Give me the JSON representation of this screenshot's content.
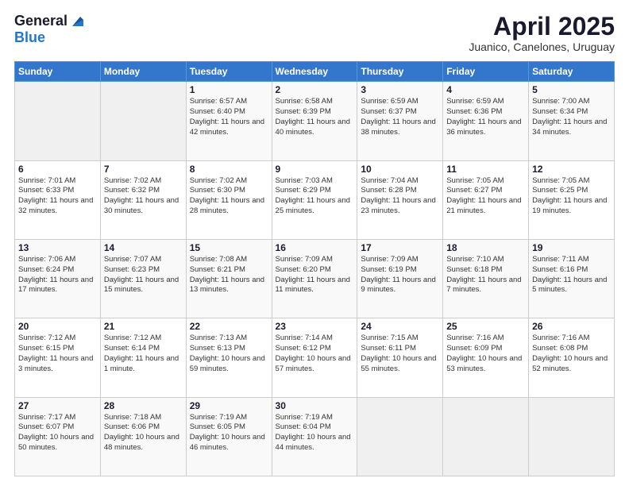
{
  "header": {
    "logo_general": "General",
    "logo_blue": "Blue",
    "month_title": "April 2025",
    "subtitle": "Juanico, Canelones, Uruguay"
  },
  "days_of_week": [
    "Sunday",
    "Monday",
    "Tuesday",
    "Wednesday",
    "Thursday",
    "Friday",
    "Saturday"
  ],
  "weeks": [
    [
      {
        "day": "",
        "info": ""
      },
      {
        "day": "",
        "info": ""
      },
      {
        "day": "1",
        "info": "Sunrise: 6:57 AM\nSunset: 6:40 PM\nDaylight: 11 hours and 42 minutes."
      },
      {
        "day": "2",
        "info": "Sunrise: 6:58 AM\nSunset: 6:39 PM\nDaylight: 11 hours and 40 minutes."
      },
      {
        "day": "3",
        "info": "Sunrise: 6:59 AM\nSunset: 6:37 PM\nDaylight: 11 hours and 38 minutes."
      },
      {
        "day": "4",
        "info": "Sunrise: 6:59 AM\nSunset: 6:36 PM\nDaylight: 11 hours and 36 minutes."
      },
      {
        "day": "5",
        "info": "Sunrise: 7:00 AM\nSunset: 6:34 PM\nDaylight: 11 hours and 34 minutes."
      }
    ],
    [
      {
        "day": "6",
        "info": "Sunrise: 7:01 AM\nSunset: 6:33 PM\nDaylight: 11 hours and 32 minutes."
      },
      {
        "day": "7",
        "info": "Sunrise: 7:02 AM\nSunset: 6:32 PM\nDaylight: 11 hours and 30 minutes."
      },
      {
        "day": "8",
        "info": "Sunrise: 7:02 AM\nSunset: 6:30 PM\nDaylight: 11 hours and 28 minutes."
      },
      {
        "day": "9",
        "info": "Sunrise: 7:03 AM\nSunset: 6:29 PM\nDaylight: 11 hours and 25 minutes."
      },
      {
        "day": "10",
        "info": "Sunrise: 7:04 AM\nSunset: 6:28 PM\nDaylight: 11 hours and 23 minutes."
      },
      {
        "day": "11",
        "info": "Sunrise: 7:05 AM\nSunset: 6:27 PM\nDaylight: 11 hours and 21 minutes."
      },
      {
        "day": "12",
        "info": "Sunrise: 7:05 AM\nSunset: 6:25 PM\nDaylight: 11 hours and 19 minutes."
      }
    ],
    [
      {
        "day": "13",
        "info": "Sunrise: 7:06 AM\nSunset: 6:24 PM\nDaylight: 11 hours and 17 minutes."
      },
      {
        "day": "14",
        "info": "Sunrise: 7:07 AM\nSunset: 6:23 PM\nDaylight: 11 hours and 15 minutes."
      },
      {
        "day": "15",
        "info": "Sunrise: 7:08 AM\nSunset: 6:21 PM\nDaylight: 11 hours and 13 minutes."
      },
      {
        "day": "16",
        "info": "Sunrise: 7:09 AM\nSunset: 6:20 PM\nDaylight: 11 hours and 11 minutes."
      },
      {
        "day": "17",
        "info": "Sunrise: 7:09 AM\nSunset: 6:19 PM\nDaylight: 11 hours and 9 minutes."
      },
      {
        "day": "18",
        "info": "Sunrise: 7:10 AM\nSunset: 6:18 PM\nDaylight: 11 hours and 7 minutes."
      },
      {
        "day": "19",
        "info": "Sunrise: 7:11 AM\nSunset: 6:16 PM\nDaylight: 11 hours and 5 minutes."
      }
    ],
    [
      {
        "day": "20",
        "info": "Sunrise: 7:12 AM\nSunset: 6:15 PM\nDaylight: 11 hours and 3 minutes."
      },
      {
        "day": "21",
        "info": "Sunrise: 7:12 AM\nSunset: 6:14 PM\nDaylight: 11 hours and 1 minute."
      },
      {
        "day": "22",
        "info": "Sunrise: 7:13 AM\nSunset: 6:13 PM\nDaylight: 10 hours and 59 minutes."
      },
      {
        "day": "23",
        "info": "Sunrise: 7:14 AM\nSunset: 6:12 PM\nDaylight: 10 hours and 57 minutes."
      },
      {
        "day": "24",
        "info": "Sunrise: 7:15 AM\nSunset: 6:11 PM\nDaylight: 10 hours and 55 minutes."
      },
      {
        "day": "25",
        "info": "Sunrise: 7:16 AM\nSunset: 6:09 PM\nDaylight: 10 hours and 53 minutes."
      },
      {
        "day": "26",
        "info": "Sunrise: 7:16 AM\nSunset: 6:08 PM\nDaylight: 10 hours and 52 minutes."
      }
    ],
    [
      {
        "day": "27",
        "info": "Sunrise: 7:17 AM\nSunset: 6:07 PM\nDaylight: 10 hours and 50 minutes."
      },
      {
        "day": "28",
        "info": "Sunrise: 7:18 AM\nSunset: 6:06 PM\nDaylight: 10 hours and 48 minutes."
      },
      {
        "day": "29",
        "info": "Sunrise: 7:19 AM\nSunset: 6:05 PM\nDaylight: 10 hours and 46 minutes."
      },
      {
        "day": "30",
        "info": "Sunrise: 7:19 AM\nSunset: 6:04 PM\nDaylight: 10 hours and 44 minutes."
      },
      {
        "day": "",
        "info": ""
      },
      {
        "day": "",
        "info": ""
      },
      {
        "day": "",
        "info": ""
      }
    ]
  ]
}
